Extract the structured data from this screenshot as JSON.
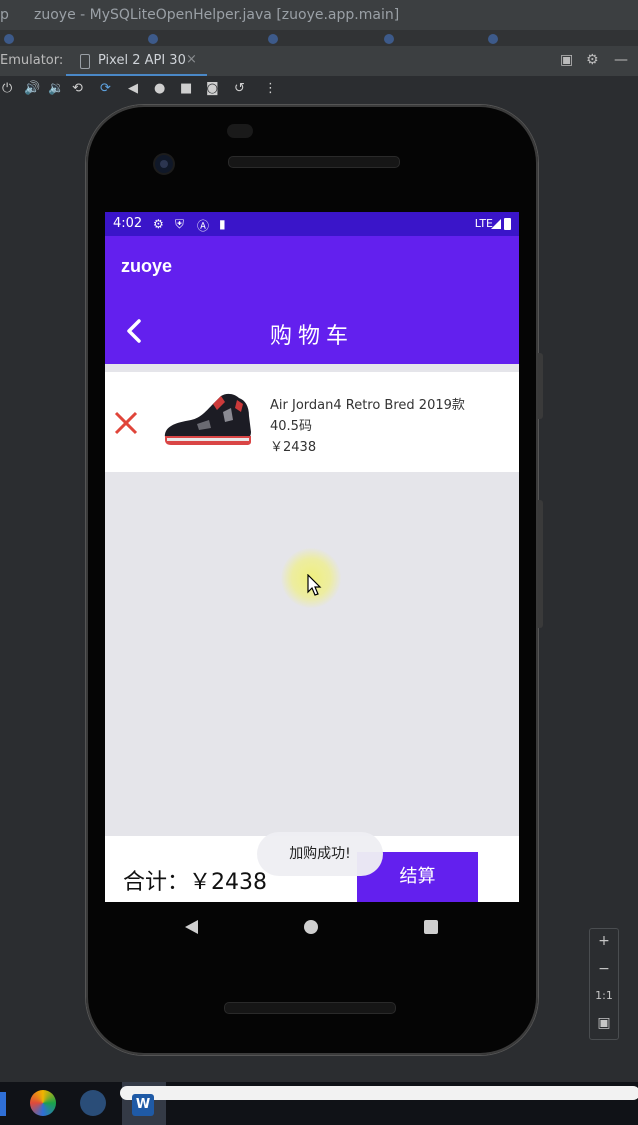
{
  "ide": {
    "window_title": "zuoye - MySQLiteOpenHelper.java [zuoye.app.main]",
    "title_prefix": "p",
    "emulator_label": "Emulator:",
    "device_tab": "Pixel 2 API 30",
    "tab_close": "×"
  },
  "zoom": {
    "plus": "+",
    "minus": "−",
    "ratio": "1:1"
  },
  "status_bar": {
    "time": "4:02",
    "network": "LTE"
  },
  "app": {
    "name": "zuoye",
    "page_title": "购物车"
  },
  "cart": {
    "items": [
      {
        "name": "Air Jordan4 Retro Bred 2019款",
        "size": "40.5码",
        "price": "￥2438"
      }
    ]
  },
  "bottom_bar": {
    "total_label": "合计：",
    "total_value": "￥2438",
    "checkout_label": "结算"
  },
  "toast": {
    "message": "加购成功!"
  },
  "colors": {
    "primary": "#6320EE",
    "status_bar": "#3A15C9",
    "delete_icon": "#E0453A"
  }
}
